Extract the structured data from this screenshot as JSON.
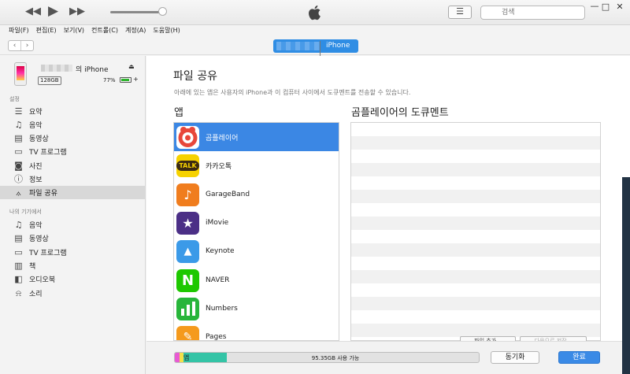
{
  "titlebar": {
    "rewind_icon": "rewind-icon",
    "play_icon": "play-icon",
    "forward_icon": "fast-forward-icon",
    "search_placeholder": "검색",
    "win_minimize": "—",
    "win_maximize": "□",
    "win_close": "✕"
  },
  "menu": [
    "파일(F)",
    "편집(E)",
    "보기(V)",
    "컨트롤(C)",
    "계정(A)",
    "도움말(H)"
  ],
  "nav": {
    "back": "‹",
    "forward": "›",
    "device_tab": "iPhone"
  },
  "device": {
    "name_suffix": "의 iPhone",
    "capacity": "128GB",
    "battery": "77%",
    "battery_level": 0.77,
    "charging": "+"
  },
  "sidebar": {
    "settings_header": "설정",
    "settings_items": [
      {
        "label": "요약",
        "icon": "☰"
      },
      {
        "label": "음악",
        "icon": "♫"
      },
      {
        "label": "동영상",
        "icon": "▤"
      },
      {
        "label": "TV 프로그램",
        "icon": "▭"
      },
      {
        "label": "사진",
        "icon": "◙"
      },
      {
        "label": "정보",
        "icon": "ⓘ"
      },
      {
        "label": "파일 공유",
        "icon": "⟑"
      }
    ],
    "selected": "파일 공유",
    "mydevice_header": "나의 기기에서",
    "device_items": [
      {
        "label": "음악",
        "icon": "♫"
      },
      {
        "label": "동영상",
        "icon": "▤"
      },
      {
        "label": "TV 프로그램",
        "icon": "▭"
      },
      {
        "label": "책",
        "icon": "▥"
      },
      {
        "label": "오디오북",
        "icon": "◧"
      },
      {
        "label": "소리",
        "icon": "⍾"
      }
    ]
  },
  "main": {
    "title": "파일 공유",
    "description": "아래에 있는 앱은 사용자의 iPhone과 이 컴퓨터 사이에서 도큐멘트를 전송할 수 있습니다.",
    "apps_header": "앱",
    "docs_header": "곰플레이어의 도큐멘트",
    "apps": [
      {
        "label": "곰플레이어",
        "color": "#e8473a",
        "glyph": "●"
      },
      {
        "label": "카카오톡",
        "color": "#f6d200",
        "glyph": "TALK"
      },
      {
        "label": "GarageBand",
        "color": "#f07d1e",
        "glyph": "♪"
      },
      {
        "label": "iMovie",
        "color": "#4b2f86",
        "glyph": "★"
      },
      {
        "label": "Keynote",
        "color": "#3b9ae8",
        "glyph": "▲"
      },
      {
        "label": "NAVER",
        "color": "#1ec800",
        "glyph": "N"
      },
      {
        "label": "Numbers",
        "color": "#27b53a",
        "glyph": "▮"
      },
      {
        "label": "Pages",
        "color": "#f59a1c",
        "glyph": "✎"
      }
    ],
    "selected_app": "곰플레이어",
    "add_file": "파일 추가...",
    "save_to": "다음으로 저장..."
  },
  "footer": {
    "app_label": "앱",
    "free_space": "95.35GB 사용 가능",
    "sync": "동기화",
    "done": "완료"
  },
  "colors": {
    "accent": "#3b87e4",
    "storage_apps": "#34c4a6",
    "storage_other": "#e85ad4"
  }
}
